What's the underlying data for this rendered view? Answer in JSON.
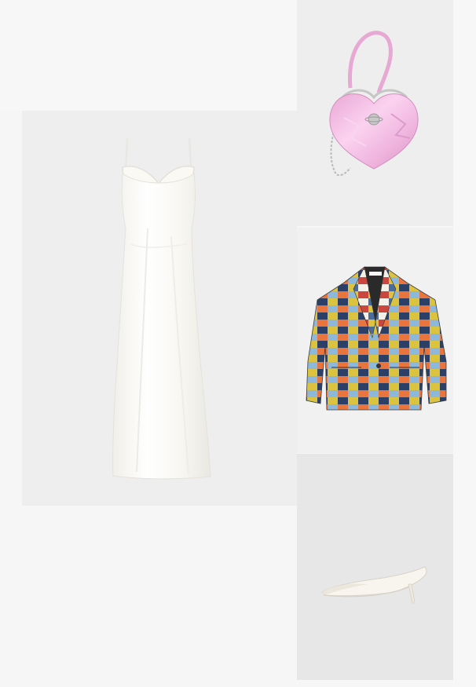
{
  "outfit": {
    "items": [
      {
        "id": "dress",
        "kind": "dress",
        "color": "#fdfcf8",
        "background": "#eeeeee"
      },
      {
        "id": "bag",
        "kind": "bag",
        "color": "#f2b2df",
        "background": "#eeeeee"
      },
      {
        "id": "jacket",
        "kind": "jacket",
        "palette": [
          "#2c3f67",
          "#dcc33f",
          "#e8743e",
          "#8eb8da",
          "#f3f0e8",
          "#6a9a5a",
          "#c9473e",
          "#4b6b9d"
        ],
        "background": "#f1f1f1"
      },
      {
        "id": "shoe",
        "kind": "shoe",
        "color": "#f7f4ec",
        "background": "#e7e7e7"
      }
    ]
  }
}
